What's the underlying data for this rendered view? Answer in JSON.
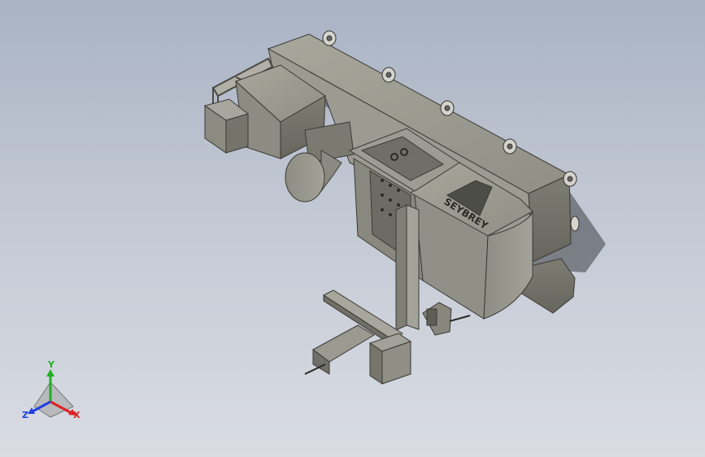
{
  "viewport": {
    "model_label": "SEYBREY",
    "background_top": "#a9b3c4",
    "background_bottom": "#d9dce3",
    "body_color": "#8a8a80"
  },
  "triad": {
    "x_label": "X",
    "y_label": "Y",
    "z_label": "Z",
    "x_color": "#e02020",
    "y_color": "#20b020",
    "z_color": "#2040e0"
  }
}
